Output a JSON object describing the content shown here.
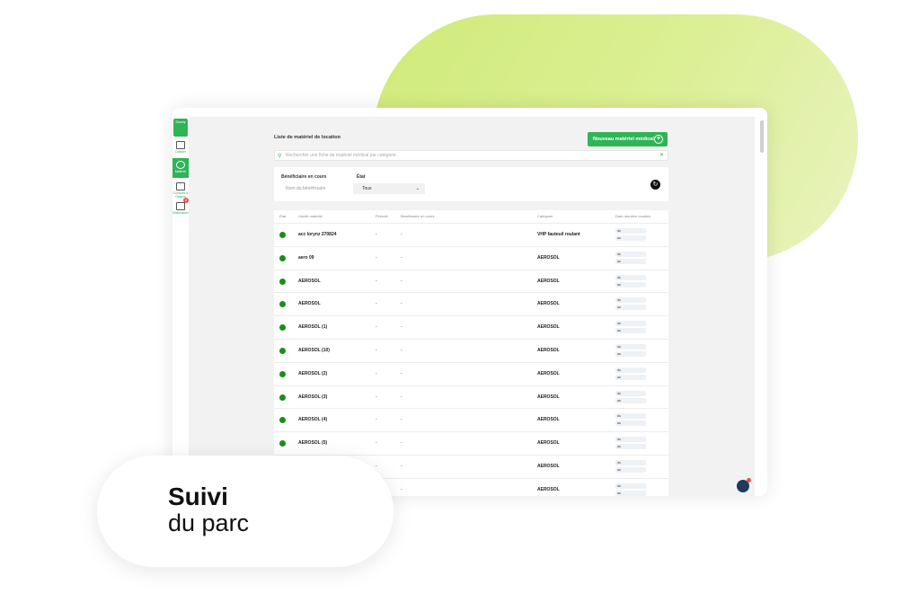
{
  "sidebar": {
    "logo": "Soarly",
    "items": [
      {
        "label": "Dossier"
      },
      {
        "label": "Matériel"
      },
      {
        "label": "Contacts & Gestion"
      },
      {
        "label": "Notifications"
      }
    ],
    "badge": "8"
  },
  "page": {
    "title": "Liste de matériel de location",
    "new_button": "Nouveau matériel médical",
    "search_placeholder": "Rechercher une fiche de matériel médical par catégorie",
    "filters": {
      "beneficiary_label": "Bénéficiaire en cours",
      "beneficiary_placeholder": "Nom du bénéficiaire",
      "state_label": "État",
      "state_value": "Tous"
    }
  },
  "table": {
    "headers": [
      "État",
      "Libellé matériel",
      "Période",
      "Bénéficiaire en cours",
      "Catégorie",
      "Date dernière location"
    ],
    "rows": [
      {
        "name": "acc lorynz 270824",
        "period": "-",
        "beneficiary": "-",
        "category": "VHP fauteuil roulant"
      },
      {
        "name": "aero 09",
        "period": "-",
        "beneficiary": "-",
        "category": "AEROSOL"
      },
      {
        "name": "AEROSOL",
        "period": "-",
        "beneficiary": "-",
        "category": "AEROSOL"
      },
      {
        "name": "AEROSOL",
        "period": "-",
        "beneficiary": "-",
        "category": "AEROSOL"
      },
      {
        "name": "AEROSOL (1)",
        "period": "-",
        "beneficiary": "-",
        "category": "AEROSOL"
      },
      {
        "name": "AEROSOL (10)",
        "period": "-",
        "beneficiary": "-",
        "category": "AEROSOL"
      },
      {
        "name": "AEROSOL (2)",
        "period": "-",
        "beneficiary": "-",
        "category": "AEROSOL"
      },
      {
        "name": "AEROSOL (3)",
        "period": "-",
        "beneficiary": "-",
        "category": "AEROSOL"
      },
      {
        "name": "AEROSOL (4)",
        "period": "-",
        "beneficiary": "-",
        "category": "AEROSOL"
      },
      {
        "name": "AEROSOL (5)",
        "period": "-",
        "beneficiary": "-",
        "category": "AEROSOL"
      },
      {
        "name": "",
        "period": "-",
        "beneficiary": "-",
        "category": "AEROSOL"
      },
      {
        "name": "",
        "period": "-",
        "beneficiary": "-",
        "category": "AEROSOL"
      }
    ],
    "pill_du": "du",
    "pill_au": "au"
  },
  "card": {
    "line1": "Suivi",
    "line2": "du parc"
  },
  "colors": {
    "accent": "#2fb457",
    "status_dot": "#1a8f1a",
    "blob": "#d4ed85"
  }
}
